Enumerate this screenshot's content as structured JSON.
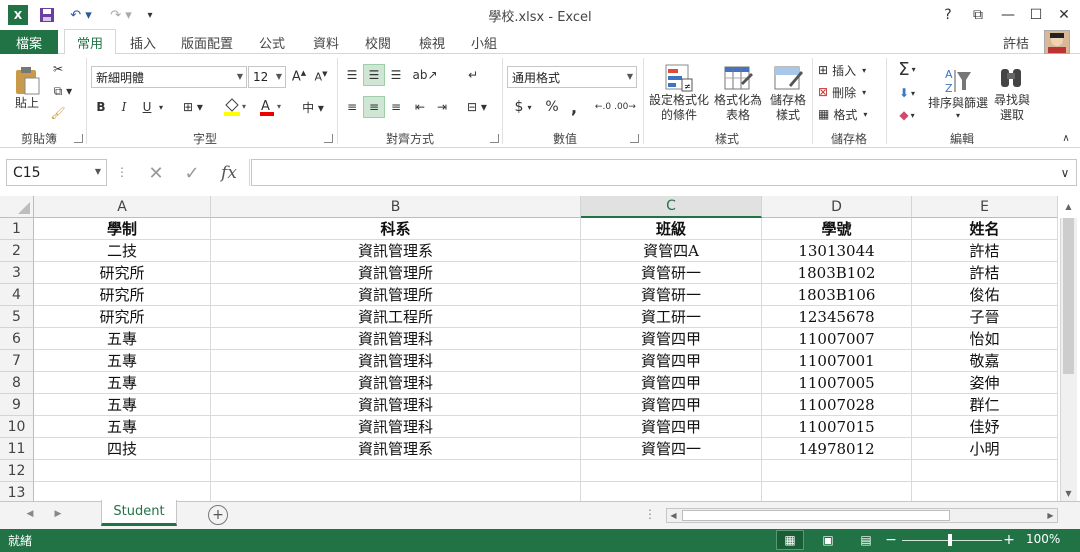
{
  "window": {
    "title": "學校.xlsx - Excel",
    "controls": {
      "help": "?",
      "restore_ribbon": "⧉",
      "minimize": "—",
      "maximize": "☐",
      "close": "✕"
    }
  },
  "tabs": [
    {
      "label": "檔案"
    },
    {
      "label": "常用"
    },
    {
      "label": "插入"
    },
    {
      "label": "版面配置"
    },
    {
      "label": "公式"
    },
    {
      "label": "資料"
    },
    {
      "label": "校閱"
    },
    {
      "label": "檢視"
    },
    {
      "label": "小組"
    }
  ],
  "user": {
    "name": "許桔"
  },
  "ribbon": {
    "clipboard": {
      "paste": "貼上",
      "group": "剪貼簿"
    },
    "font": {
      "name": "新細明體",
      "size": "12",
      "bold": "B",
      "italic": "I",
      "underline": "U",
      "group": "字型"
    },
    "alignment": {
      "group": "對齊方式"
    },
    "number": {
      "format": "通用格式",
      "currency": "$",
      "percent": "%",
      "comma": ",",
      "group": "數值"
    },
    "styles": {
      "conditional_l1": "設定格式化",
      "conditional_l2": "的條件",
      "table_l1": "格式化為",
      "table_l2": "表格",
      "cell_l1": "儲存格",
      "cell_l2": "樣式",
      "group": "樣式"
    },
    "cells": {
      "insert": "插入",
      "delete": "刪除",
      "format": "格式",
      "group": "儲存格"
    },
    "editing": {
      "sort_l1": "排序與篩選",
      "find_l1": "尋找與",
      "find_l2": "選取",
      "group": "編輯"
    }
  },
  "formula_bar": {
    "name_box": "C15",
    "fx": "fx",
    "value": ""
  },
  "columns": [
    "A",
    "B",
    "C",
    "D",
    "E"
  ],
  "selected_column": "C",
  "rows": [
    {
      "n": "1",
      "cells": [
        "學制",
        "科系",
        "班級",
        "學號",
        "姓名"
      ]
    },
    {
      "n": "2",
      "cells": [
        "二技",
        "資訊管理系",
        "資管四A",
        "13013044",
        "許桔"
      ]
    },
    {
      "n": "3",
      "cells": [
        "研究所",
        "資訊管理所",
        "資管研一",
        "1803B102",
        "許桔"
      ]
    },
    {
      "n": "4",
      "cells": [
        "研究所",
        "資訊管理所",
        "資管研一",
        "1803B106",
        "俊佑"
      ]
    },
    {
      "n": "5",
      "cells": [
        "研究所",
        "資訊工程所",
        "資工研一",
        "12345678",
        "子晉"
      ]
    },
    {
      "n": "6",
      "cells": [
        "五專",
        "資訊管理科",
        "資管四甲",
        "11007007",
        "怡如"
      ]
    },
    {
      "n": "7",
      "cells": [
        "五專",
        "資訊管理科",
        "資管四甲",
        "11007001",
        "敬嘉"
      ]
    },
    {
      "n": "8",
      "cells": [
        "五專",
        "資訊管理科",
        "資管四甲",
        "11007005",
        "姿伸"
      ]
    },
    {
      "n": "9",
      "cells": [
        "五專",
        "資訊管理科",
        "資管四甲",
        "11007028",
        "群仁"
      ]
    },
    {
      "n": "10",
      "cells": [
        "五專",
        "資訊管理科",
        "資管四甲",
        "11007015",
        "佳妤"
      ]
    },
    {
      "n": "11",
      "cells": [
        "四技",
        "資訊管理系",
        "資管四一",
        "14978012",
        "小明"
      ]
    },
    {
      "n": "12",
      "cells": [
        "",
        "",
        "",
        "",
        ""
      ]
    },
    {
      "n": "13",
      "cells": [
        "",
        "",
        "",
        "",
        ""
      ]
    }
  ],
  "sheets": [
    {
      "label": "Student"
    }
  ],
  "status": {
    "text": "就緒",
    "zoom": "100%",
    "zoom_minus": "−",
    "zoom_plus": "+"
  },
  "colors": {
    "accent": "#217346"
  }
}
